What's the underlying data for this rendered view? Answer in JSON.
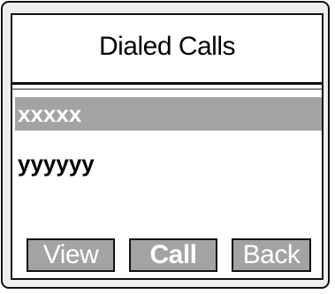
{
  "screen": {
    "title": "Dialed Calls"
  },
  "calls": [
    {
      "label": "xxxxx",
      "selected": true
    },
    {
      "label": "yyyyyy",
      "selected": false
    }
  ],
  "softkeys": {
    "left": "View",
    "center": "Call",
    "right": "Back"
  }
}
